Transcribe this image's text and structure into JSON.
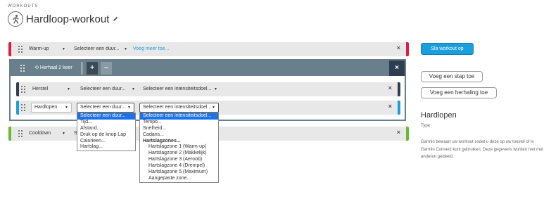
{
  "breadcrumb": "WORKOUTS",
  "title": "Hardloop-workout",
  "warmup": {
    "type": "Warm-up",
    "duration": "Selecteer een duur...",
    "more_link": "Voeg meer toe..."
  },
  "repeat": {
    "label": "Herhaal 2 keer",
    "plus": "+",
    "minus": "–",
    "close": "×"
  },
  "recovery": {
    "type": "Herstel",
    "duration": "Selecteer een duur...",
    "intensity": "Selecteer een intensiteitsdoel..."
  },
  "run": {
    "type": "Hardlopen",
    "duration": "Selecteer een duur...",
    "intensity": "Selecteer een intensiteitsdoel..."
  },
  "cooldown": {
    "type": "Cooldown",
    "duration": "S"
  },
  "duration_options": [
    "Selecteer een duur...",
    "Tijd...",
    "Afstand...",
    "Druk op de knop Lap",
    "Calorieen...",
    "Hartslag..."
  ],
  "intensity_options": [
    {
      "label": "Selecteer een intensiteitsdoel...",
      "kind": "selected"
    },
    {
      "label": "Tempo...",
      "kind": "item"
    },
    {
      "label": "Snelheid...",
      "kind": "item"
    },
    {
      "label": "Cadans...",
      "kind": "item"
    },
    {
      "label": "Hartslagzones...",
      "kind": "group"
    },
    {
      "label": "Hartslagzone 1 (Warm-up)",
      "kind": "indent"
    },
    {
      "label": "Hartslagzone 2 (Makkelijk)",
      "kind": "indent"
    },
    {
      "label": "Hartslagzone 3 (Aeroob)",
      "kind": "indent"
    },
    {
      "label": "Hartslagzone 4 (Drempel)",
      "kind": "indent"
    },
    {
      "label": "Hartslagzone 5 (Maximum)",
      "kind": "indent"
    },
    {
      "label": "Aangepaste zone...",
      "kind": "indent"
    }
  ],
  "sidebar": {
    "save": "Sla workout op",
    "add_step": "Voeg een stap toe",
    "add_repeat": "Voeg een herhaling toe",
    "sport_title": "Hardlopen",
    "sport_sub": "Type",
    "info": "Garmin bewaart uw workout zodat u deze op uw toestel of in Garmin Connect kunt gebruiken. Deze gegevens worden niet met anderen gedeeld."
  },
  "close_x": "×",
  "colors": {
    "warmup": "#e5193f",
    "repeat": "#6a7f8c",
    "recovery": "#2c3e50",
    "run": "#1a9fdc",
    "cooldown": "#6ab92e",
    "primary": "#1a9fdc"
  }
}
